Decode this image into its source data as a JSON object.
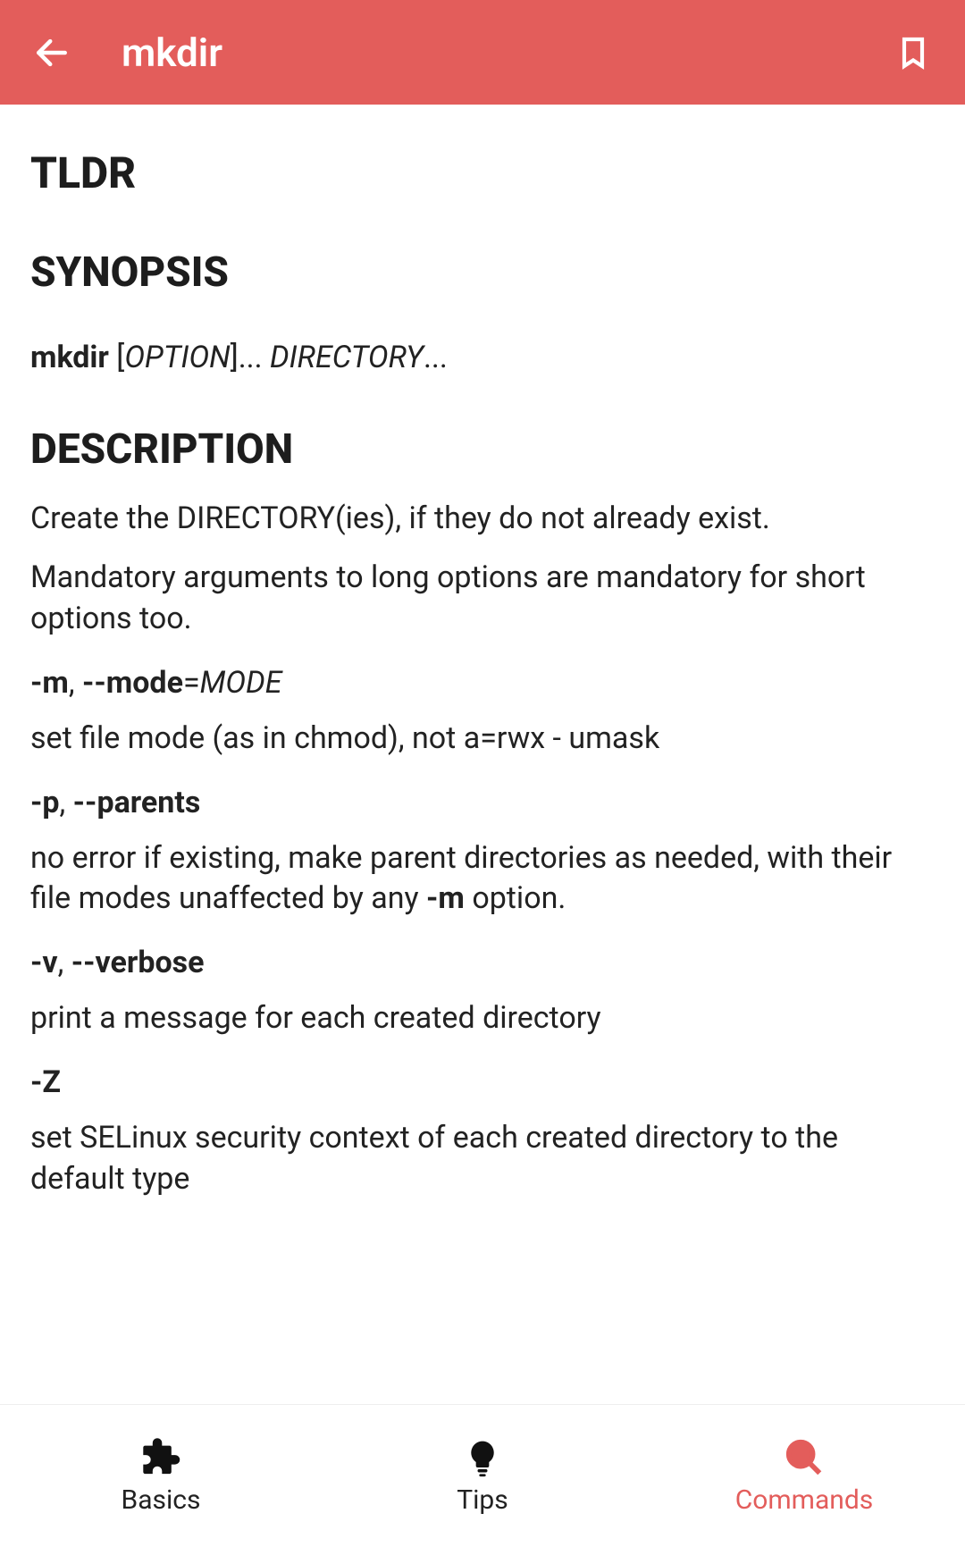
{
  "header": {
    "title": "mkdir"
  },
  "sections": {
    "tldr_heading": "TLDR",
    "synopsis_heading": "SYNOPSIS",
    "synopsis": {
      "cmd": "mkdir",
      "rest_prefix": " [",
      "opt": "OPTION",
      "rest_mid": "]... ",
      "dir": "DIRECTORY",
      "rest_suffix": "..."
    },
    "description_heading": "DESCRIPTION",
    "description_p1": "Create the DIRECTORY(ies), if they do not already exist.",
    "description_p2": "Mandatory arguments to long options are mandatory for short options too.",
    "options": [
      {
        "short": "-m",
        "sep": ", ",
        "long": "--mode",
        "eq": "=",
        "val": "MODE",
        "desc": "set file mode (as in chmod), not a=rwx - umask"
      },
      {
        "short": "-p",
        "sep": ", ",
        "long": "--parents",
        "eq": "",
        "val": "",
        "desc_pre": "no error if existing, make parent directories as needed, with their file modes unaffected by any ",
        "desc_bold": "-m",
        "desc_post": " option."
      },
      {
        "short": "-v",
        "sep": ", ",
        "long": "--verbose",
        "eq": "",
        "val": "",
        "desc": "print a message for each created directory"
      },
      {
        "short": "-Z",
        "sep": "",
        "long": "",
        "eq": "",
        "val": "",
        "desc": "set SELinux security context of each created directory to the default type"
      }
    ]
  },
  "nav": {
    "basics": "Basics",
    "tips": "Tips",
    "commands": "Commands"
  }
}
